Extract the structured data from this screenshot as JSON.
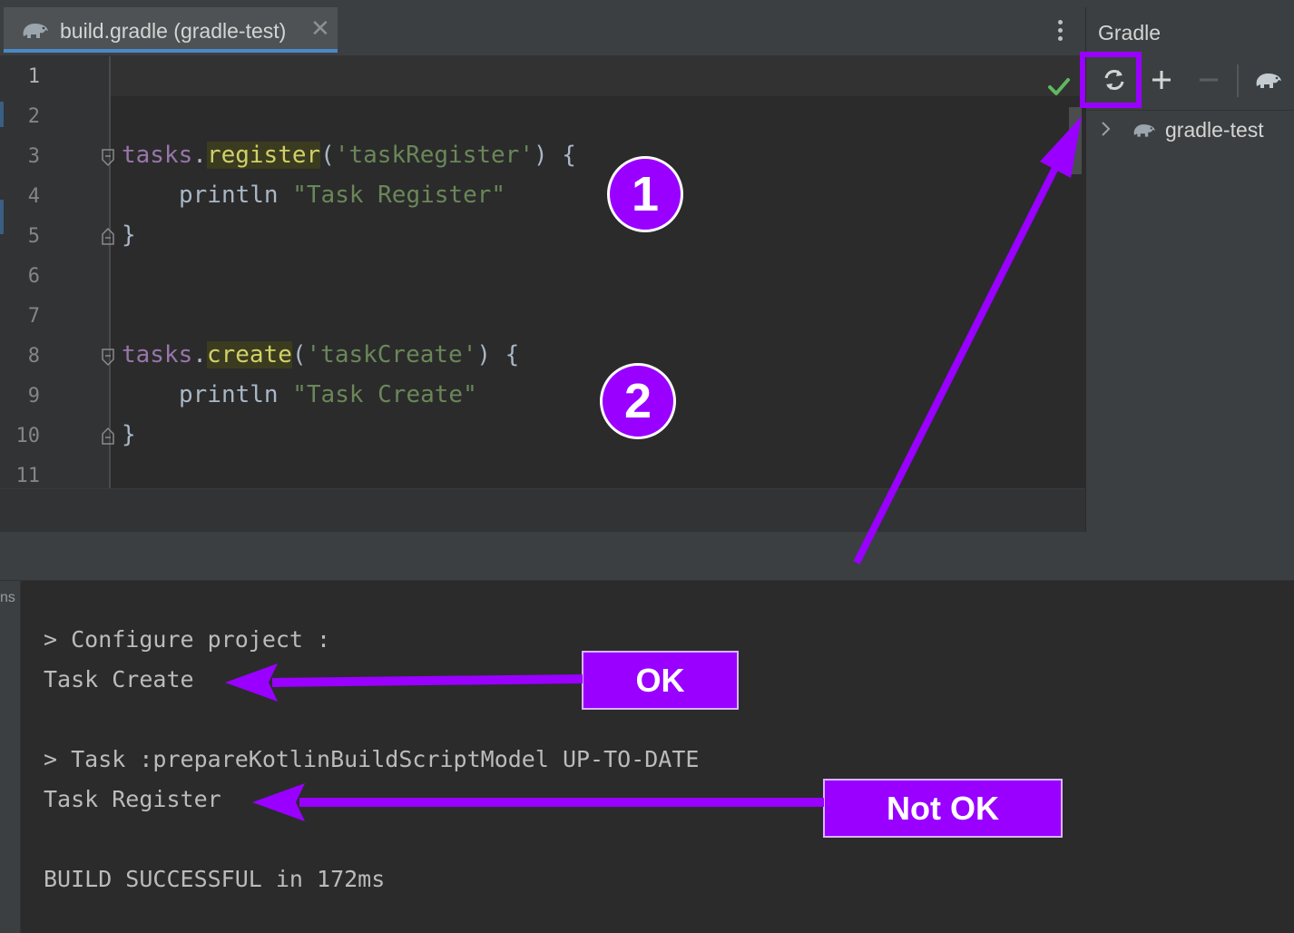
{
  "editor": {
    "tab": {
      "title": "build.gradle (gradle-test)",
      "close_glyph": "✕",
      "icon": "gradle-elephant-icon"
    },
    "line_numbers": [
      "1",
      "2",
      "3",
      "4",
      "5",
      "6",
      "7",
      "8",
      "9",
      "10",
      "11"
    ],
    "code": {
      "line3": {
        "obj": "tasks",
        "dot": ".",
        "method": "register",
        "open": "(",
        "arg": "'taskRegister'",
        "close": ") {"
      },
      "line4": {
        "fn": "println",
        "str": "\"Task Register\""
      },
      "line5": "}",
      "line8": {
        "obj": "tasks",
        "dot": ".",
        "method": "create",
        "open": "(",
        "arg": "'taskCreate'",
        "close": ") {"
      },
      "line9": {
        "fn": "println",
        "str": "\"Task Create\""
      },
      "line10": "}"
    },
    "inspection_status": "check-icon"
  },
  "gradle_panel": {
    "title": "Gradle",
    "toolbar": [
      "refresh-icon",
      "plus-icon",
      "minus-icon",
      "gradle-elephant-icon"
    ],
    "tree": [
      {
        "label": "gradle-test",
        "icon": "gradle-elephant-icon",
        "expanded": false
      }
    ]
  },
  "console": {
    "side_label": "ns",
    "lines": {
      "configure": "> Configure project :",
      "task_create": "Task Create",
      "prepare": "> Task :prepareKotlinBuildScriptModel UP-TO-DATE",
      "task_register": "Task Register",
      "build": "BUILD SUCCESSFUL in 172ms"
    }
  },
  "annotations": {
    "badge1": "1",
    "badge2": "2",
    "ok_label": "OK",
    "not_ok_label": "Not OK",
    "color": "#9900ff"
  }
}
